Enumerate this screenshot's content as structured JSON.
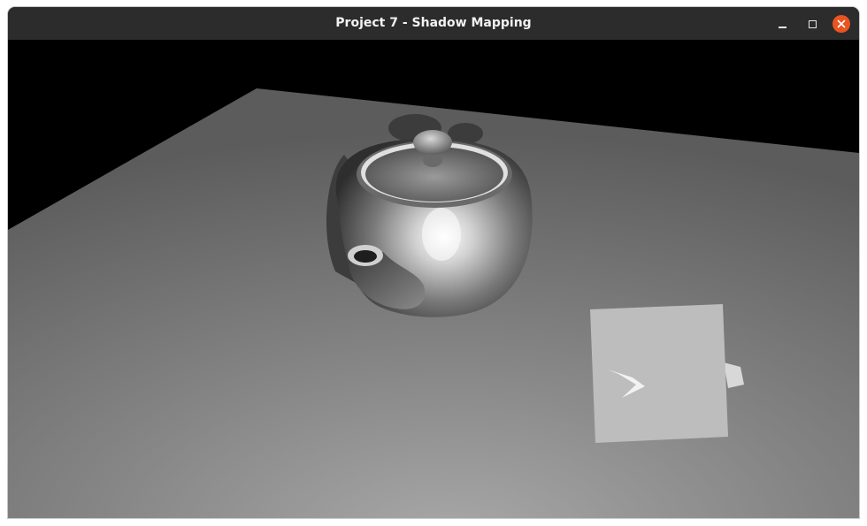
{
  "window": {
    "title": "Project 7 - Shadow Mapping",
    "controls": {
      "minimize": "minimize",
      "maximize": "maximize",
      "close": "close"
    }
  },
  "scene": {
    "background_color": "#000000",
    "objects": [
      "floor-plane",
      "teapot",
      "teapot-shadow",
      "light-cube"
    ]
  },
  "colors": {
    "titlebar": "#2c2c2c",
    "close_button": "#e95420"
  }
}
